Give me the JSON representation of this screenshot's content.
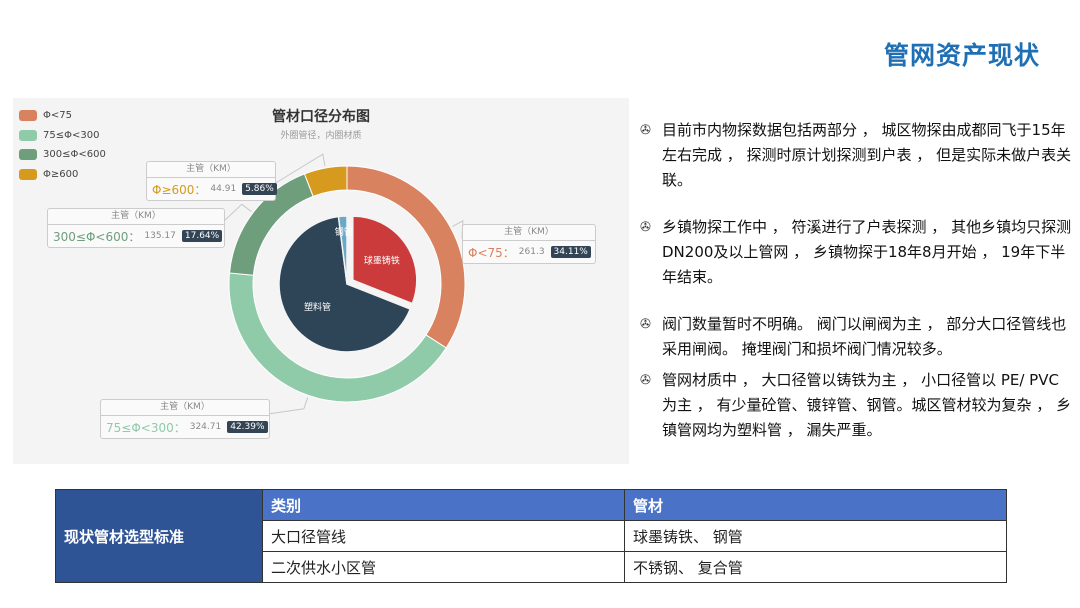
{
  "page_title": "管网资产现状",
  "chart_data": {
    "type": "pie",
    "title": "管材口径分布图",
    "subtitle": "外圈管径，内圈材质",
    "legend_position": "top-left",
    "outer_series": [
      {
        "name": "Φ<75",
        "value": 261.3,
        "percent": "34.11%",
        "color": "#d9825f",
        "callout_head": "主管（KM）",
        "callout_label": "Φ<75：",
        "callout_value": "261.3"
      },
      {
        "name": "75≤Φ<300",
        "value": 324.71,
        "percent": "42.39%",
        "color": "#8fcaa9",
        "callout_head": "主管（KM）",
        "callout_label": "75≤Φ<300：",
        "callout_value": "324.71"
      },
      {
        "name": "300≤Φ<600",
        "value": 135.17,
        "percent": "17.64%",
        "color": "#6e9e7c",
        "callout_head": "主管（KM）",
        "callout_label": "300≤Φ<600：",
        "callout_value": "135.17"
      },
      {
        "name": "Φ≥600",
        "value": 44.91,
        "percent": "5.86%",
        "color": "#d69a1e",
        "callout_head": "主管（KM）",
        "callout_label": "Φ≥600：",
        "callout_value": "44.91"
      }
    ],
    "inner_series": [
      {
        "name": "球墨铸铁",
        "value": 31,
        "color": "#cc3b3b"
      },
      {
        "name": "塑料管",
        "value": 67,
        "color": "#2e4457"
      },
      {
        "name": "钢管",
        "value": 2,
        "color": "#6aa8c8"
      }
    ]
  },
  "bullets": [
    {
      "icon": "✇",
      "text": "目前市内物探数据包括两部分 ， 城区物探由成都同飞于15年左右完成 ， 探测时原计划探测到户表 ， 但是实际未做户表关联。"
    },
    {
      "icon": "✇",
      "text": "乡镇物探工作中 ， 符溪进行了户表探测 ， 其他乡镇均只探测DN200及以上管网 ， 乡镇物探于18年8月开始 ， 19年下半年结束。"
    },
    {
      "icon": "✇",
      "text": "阀门数量暂时不明确。 阀门以闸阀为主 ， 部分大口径管线也采用闸阀。 掩埋阀门和损坏阀门情况较多。"
    },
    {
      "icon": "✇",
      "text": "管网材质中 ， 大口径管以铸铁为主 ， 小口径管以 PE/ PVC为主 ， 有少量砼管、镀锌管、钢管。城区管材较为复杂 ， 乡镇管网均为塑料管 ， 漏失严重。"
    }
  ],
  "table": {
    "row_header": "现状管材选型标准",
    "columns": [
      "类别",
      "管材"
    ],
    "rows": [
      [
        "大口径管线",
        "球墨铸铁、 钢管"
      ],
      [
        "二次供水小区管",
        "不锈钢、 复合管"
      ]
    ]
  }
}
